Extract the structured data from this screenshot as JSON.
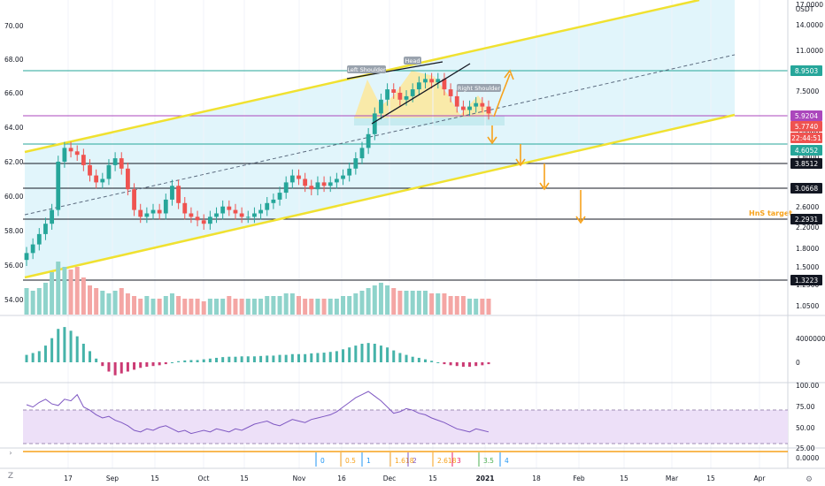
{
  "chart_data": {
    "type": "candlestick",
    "title": "",
    "currency": "USDT",
    "main_pane": {
      "left_axis": {
        "ticks": [
          "70.00",
          "68.00",
          "66.00",
          "64.00",
          "62.00",
          "60.00",
          "58.00",
          "56.00",
          "54.00"
        ]
      },
      "right_axis": {
        "scale": "log",
        "ticks": [
          "17.0000",
          "14.0000",
          "11.0000",
          "9.5000",
          "7.5000",
          "6.0000",
          "5.0000",
          "3.8000",
          "3.0000",
          "2.6000",
          "2.2000",
          "1.8000",
          "1.5000",
          "1.2500",
          "1.0500"
        ]
      },
      "price_lines": [
        {
          "label": "8.9503",
          "color": "#26a69a"
        },
        {
          "label": "5.9204",
          "color": "#ab47bc"
        },
        {
          "label": "5.7740",
          "color": "#ef5350"
        },
        {
          "label": "22:44:51",
          "color": "#ef5350"
        },
        {
          "label": "4.6052",
          "color": "#26a69a"
        },
        {
          "label": "3.8512",
          "color": "#131722"
        },
        {
          "label": "3.0668",
          "color": "#131722"
        },
        {
          "label": "2.2931",
          "color": "#131722"
        },
        {
          "label": "1.3223",
          "color": "#131722"
        }
      ],
      "annotations": [
        {
          "text": "Left Shoulder"
        },
        {
          "text": "Head"
        },
        {
          "text": "Right Shoulder"
        },
        {
          "text": "HnS target",
          "color": "#f7a21b"
        }
      ],
      "close_values": [
        56.7,
        57.2,
        57.8,
        58.4,
        59.2,
        62.0,
        62.8,
        62.6,
        62.4,
        61.8,
        61.2,
        60.8,
        61.0,
        61.8,
        62.2,
        61.6,
        60.4,
        59.2,
        58.8,
        59.0,
        59.2,
        59.0,
        59.8,
        60.6,
        59.6,
        59.0,
        58.8,
        58.6,
        58.4,
        58.8,
        59.0,
        59.4,
        59.2,
        59.0,
        58.8,
        58.8,
        59.0,
        59.2,
        59.6,
        59.8,
        60.2,
        60.8,
        61.2,
        61.0,
        60.6,
        60.4,
        60.8,
        60.6,
        60.8,
        61.0,
        61.2,
        61.6,
        62.2,
        62.8,
        63.6,
        64.8,
        65.6,
        66.2,
        66.0,
        65.6,
        65.8,
        66.2,
        66.6,
        66.8,
        66.6,
        66.8,
        66.2,
        65.8,
        65.2,
        65.0,
        65.2,
        65.4,
        65.2,
        64.8
      ]
    },
    "volume": {
      "values": [
        0.5,
        0.45,
        0.5,
        0.6,
        0.8,
        1.0,
        0.9,
        0.85,
        0.9,
        0.7,
        0.55,
        0.5,
        0.45,
        0.4,
        0.45,
        0.5,
        0.4,
        0.35,
        0.3,
        0.35,
        0.3,
        0.3,
        0.35,
        0.4,
        0.35,
        0.3,
        0.3,
        0.3,
        0.25,
        0.3,
        0.3,
        0.3,
        0.35,
        0.3,
        0.3,
        0.3,
        0.3,
        0.3,
        0.35,
        0.35,
        0.35,
        0.4,
        0.4,
        0.35,
        0.3,
        0.3,
        0.3,
        0.3,
        0.3,
        0.3,
        0.35,
        0.35,
        0.4,
        0.45,
        0.5,
        0.55,
        0.6,
        0.55,
        0.5,
        0.45,
        0.45,
        0.45,
        0.45,
        0.45,
        0.4,
        0.4,
        0.4,
        0.35,
        0.35,
        0.35,
        0.3,
        0.3,
        0.3,
        0.3
      ]
    },
    "macd_pane": {
      "ticks": [
        "4000000",
        "0"
      ],
      "histogram": [
        0.2,
        0.25,
        0.3,
        0.45,
        0.65,
        0.9,
        0.95,
        0.85,
        0.7,
        0.5,
        0.3,
        0.1,
        -0.1,
        -0.25,
        -0.35,
        -0.3,
        -0.25,
        -0.2,
        -0.15,
        -0.12,
        -0.1,
        -0.08,
        -0.05,
        0.0,
        0.03,
        0.05,
        0.06,
        0.06,
        0.08,
        0.1,
        0.12,
        0.14,
        0.15,
        0.15,
        0.16,
        0.16,
        0.16,
        0.17,
        0.18,
        0.18,
        0.2,
        0.2,
        0.22,
        0.22,
        0.22,
        0.24,
        0.25,
        0.26,
        0.28,
        0.3,
        0.35,
        0.4,
        0.45,
        0.5,
        0.52,
        0.5,
        0.45,
        0.4,
        0.32,
        0.25,
        0.2,
        0.15,
        0.12,
        0.08,
        0.04,
        0.0,
        -0.05,
        -0.08,
        -0.1,
        -0.12,
        -0.12,
        -0.1,
        -0.08,
        -0.05
      ]
    },
    "rsi_pane": {
      "ticks": [
        "100.00",
        "75.00",
        "50.00",
        "25.00"
      ],
      "band": [
        30,
        70
      ],
      "values": [
        75,
        72,
        78,
        82,
        76,
        74,
        82,
        80,
        88,
        72,
        68,
        62,
        58,
        60,
        55,
        52,
        48,
        42,
        40,
        44,
        42,
        46,
        48,
        44,
        40,
        42,
        38,
        40,
        42,
        40,
        44,
        42,
        40,
        44,
        42,
        46,
        50,
        52,
        54,
        50,
        48,
        52,
        56,
        54,
        52,
        56,
        58,
        60,
        62,
        66,
        72,
        78,
        84,
        88,
        92,
        86,
        80,
        72,
        64,
        66,
        70,
        68,
        64,
        62,
        58,
        55,
        52,
        48,
        44,
        42,
        40,
        44,
        42,
        40
      ]
    },
    "fib_pane": {
      "ticks": [
        "0.0000"
      ],
      "labels": [
        "0",
        "0.5",
        "1",
        "1.618",
        "2",
        "2.618",
        "3",
        "3.5",
        "4"
      ]
    },
    "x_axis": {
      "ticks": [
        "17",
        "Sep",
        "15",
        "Oct",
        "15",
        "Nov",
        "16",
        "Dec",
        "15",
        "2021",
        "18",
        "Feb",
        "15",
        "Mar",
        "15",
        "Apr"
      ]
    }
  }
}
